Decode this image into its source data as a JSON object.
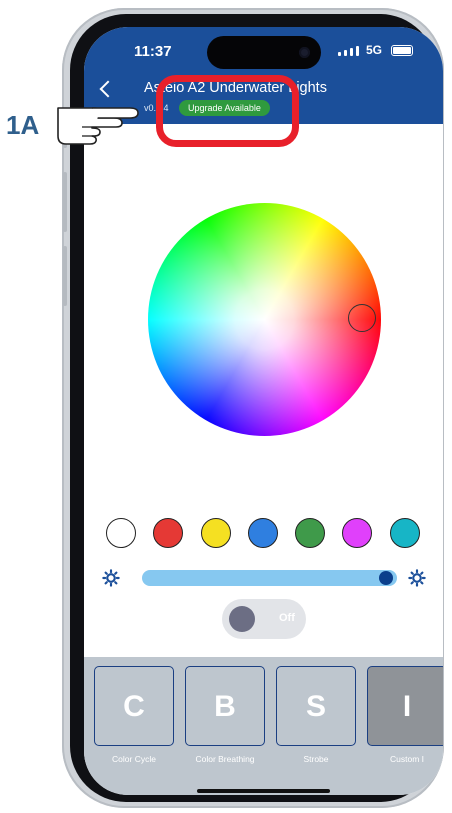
{
  "status_bar": {
    "time": "11:37",
    "network": "5G"
  },
  "header": {
    "title": "Asteio A2 Underwater Lights",
    "version": "v0.1.4",
    "upgrade_badge": "Upgrade Available"
  },
  "color_wheel": {
    "selected_hue": "red-orange"
  },
  "swatches": [
    "#ffffff",
    "#e53935",
    "#f5e022",
    "#2f7fe0",
    "#3f9a4a",
    "#e040fb",
    "#17b5c6"
  ],
  "brightness": {
    "level_percent": 95
  },
  "power_toggle": {
    "label": "Off",
    "state": "off"
  },
  "modes": [
    {
      "letter": "C",
      "caption": "Color Cycle"
    },
    {
      "letter": "B",
      "caption": "Color Breathing"
    },
    {
      "letter": "S",
      "caption": "Strobe"
    },
    {
      "letter": "I",
      "caption": "Custom I"
    }
  ],
  "annotation": {
    "label": "1A",
    "highlight_color": "#e8202a"
  },
  "colors": {
    "header": "#1b4f9a",
    "accent": "#0b3f8c",
    "slider": "#86c8f0",
    "badge": "#2f9a3e"
  }
}
